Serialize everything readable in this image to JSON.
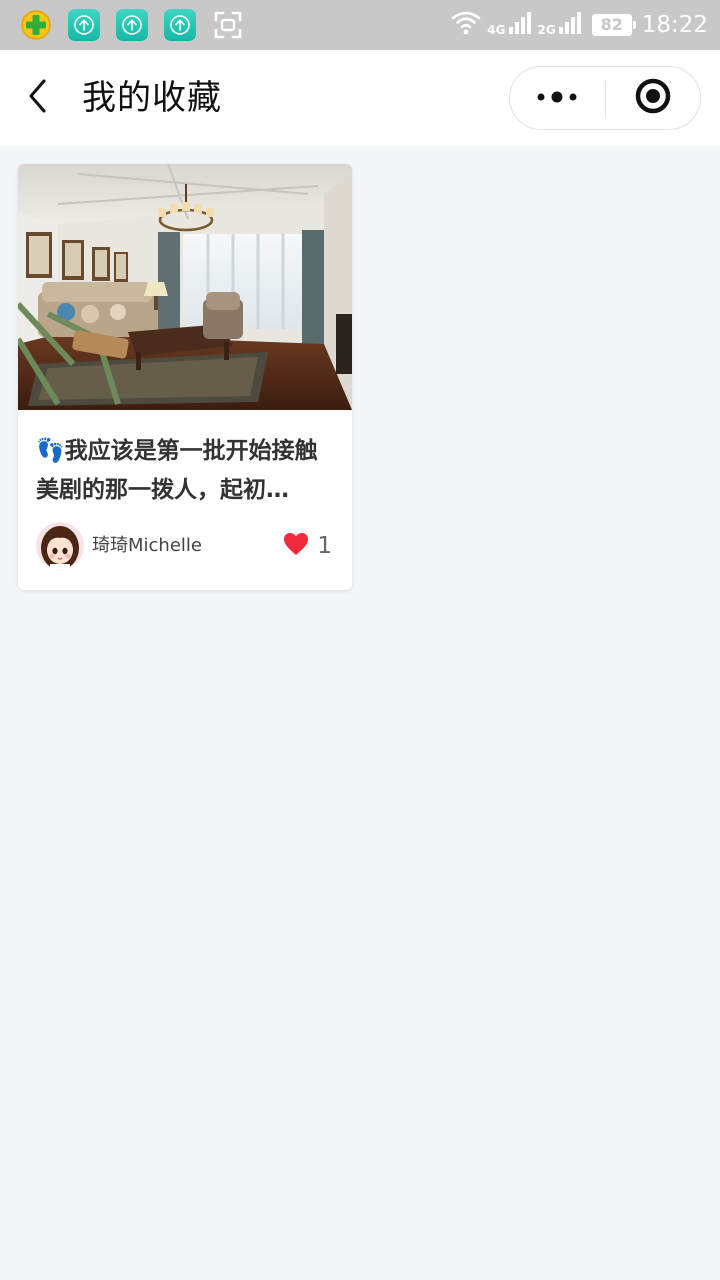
{
  "status_bar": {
    "apps": [
      {
        "icon": "security-guard-icon"
      },
      {
        "icon": "upload-arrow-icon"
      },
      {
        "icon": "upload-arrow-icon"
      },
      {
        "icon": "upload-arrow-icon"
      },
      {
        "icon": "screenshot-icon"
      }
    ],
    "network_1": "4G",
    "network_2": "2G",
    "battery": "82",
    "time": "18:22"
  },
  "nav": {
    "title": "我的收藏",
    "back_icon": "chevron-left-icon",
    "more_icon": "more-dots-icon",
    "close_icon": "target-close-icon"
  },
  "cards": [
    {
      "image": "living-room-photo",
      "title": "👣我应该是第一批开始接触美剧的那一拨人，起初…",
      "author": "琦琦Michelle",
      "likes": "1"
    }
  ],
  "colors": {
    "status_bar_bg": "#c8c8c8",
    "page_bg": "#f3f6f9",
    "nav_bg": "#ffffff",
    "like_heart": "#f0293e",
    "teal_app": "#14b8a6"
  }
}
